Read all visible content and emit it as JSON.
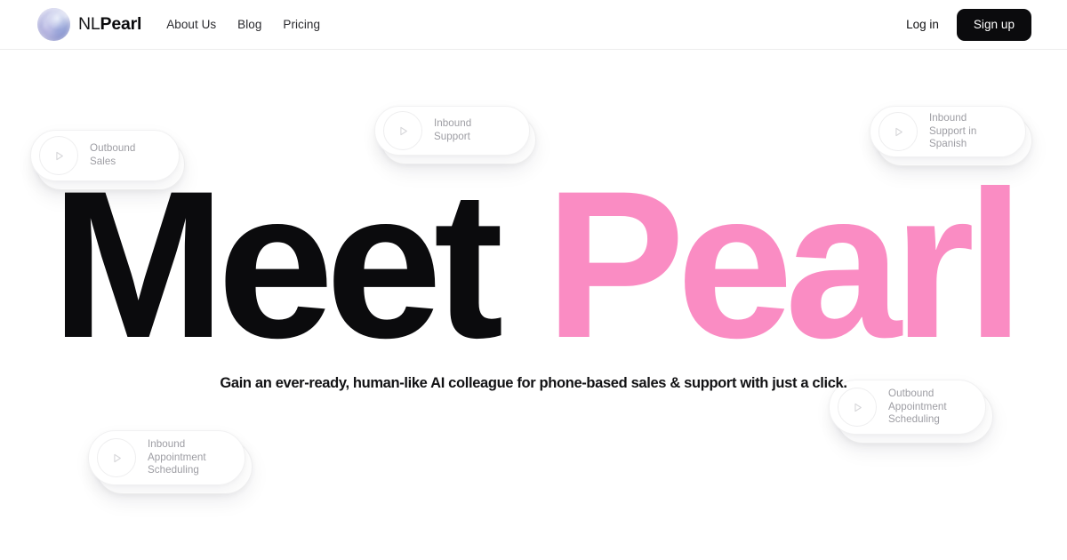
{
  "brand": {
    "logo_icon": "gradient-orb-logo",
    "name_light": "NL",
    "name_bold": "Pearl"
  },
  "nav": {
    "links": [
      {
        "label": "About Us"
      },
      {
        "label": "Blog"
      },
      {
        "label": "Pricing"
      }
    ],
    "login_label": "Log in",
    "signup_label": "Sign up"
  },
  "hero": {
    "headline_dark": "Meet",
    "headline_pink": "Pearl",
    "subtitle": "Gain an ever-ready, human-like AI colleague for phone-based sales & support with just a click."
  },
  "pills": [
    {
      "id": "outbound-sales",
      "label": "Outbound Sales",
      "icon": "play-icon"
    },
    {
      "id": "inbound-support",
      "label": "Inbound Support",
      "icon": "play-icon"
    },
    {
      "id": "inbound-spanish",
      "label": "Inbound Support in\nSpanish",
      "icon": "play-icon"
    },
    {
      "id": "outbound-appt",
      "label": "Outbound\nAppointment\nScheduling",
      "icon": "play-icon"
    },
    {
      "id": "inbound-appt",
      "label": "Inbound\nAppointment\nScheduling",
      "icon": "play-icon"
    }
  ],
  "colors": {
    "accent_pink": "#fa8cc3",
    "ink": "#0b0b0d",
    "muted": "#9d9da3",
    "hairline": "#ececed"
  }
}
